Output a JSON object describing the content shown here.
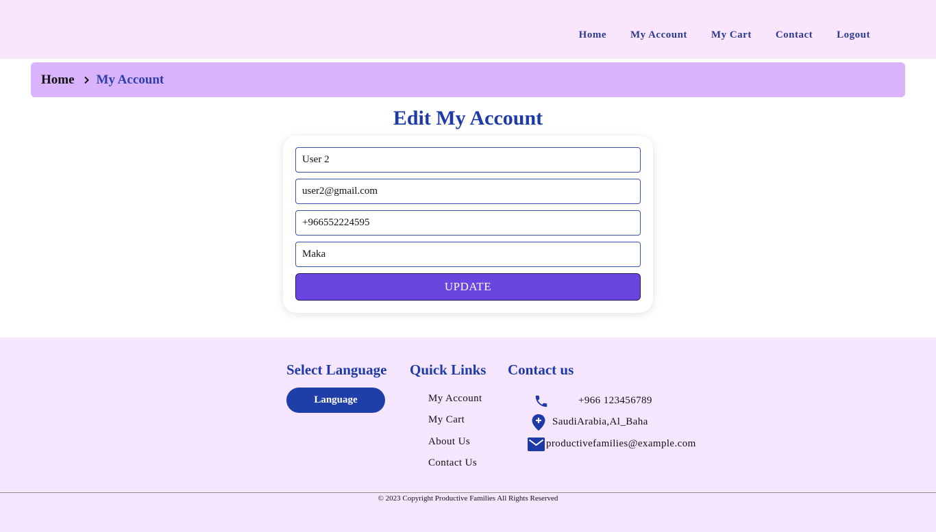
{
  "nav": {
    "items": [
      "Home",
      "My Account",
      "My Cart",
      "Contact",
      "Logout"
    ]
  },
  "breadcrumb": {
    "home": "Home",
    "current": "My Account"
  },
  "page": {
    "title": "Edit My Account"
  },
  "form": {
    "name_value": "User 2",
    "email_value": "user2@gmail.com",
    "phone_value": "+966552224595",
    "city_value": "Maka",
    "update_label": "UPDATE"
  },
  "footer": {
    "language": {
      "heading": "Select Language",
      "button_label": "Language"
    },
    "quick_links": {
      "heading": "Quick Links",
      "items": [
        "My Account",
        "My Cart",
        "About Us",
        "Contact Us"
      ]
    },
    "contact": {
      "heading": "Contact us",
      "phone": "+966 123456789",
      "address": "SaudiArabia,Al_Baha",
      "email": "productivefamilies@example.com"
    },
    "copyright": "© 2023 Copyright Productive Families All Rights Reserved"
  },
  "colors": {
    "header_bg": "#f9e6fd",
    "breadcrumb_bg": "#d9b3fc",
    "primary_blue": "#1e3aa8",
    "update_button": "#6b45e0",
    "footer_bg": "#f5e5fd"
  },
  "icons": {
    "breadcrumb_separator": "chevron-right-icon",
    "phone": "phone-icon",
    "address": "location-pin-icon",
    "email": "envelope-icon"
  }
}
